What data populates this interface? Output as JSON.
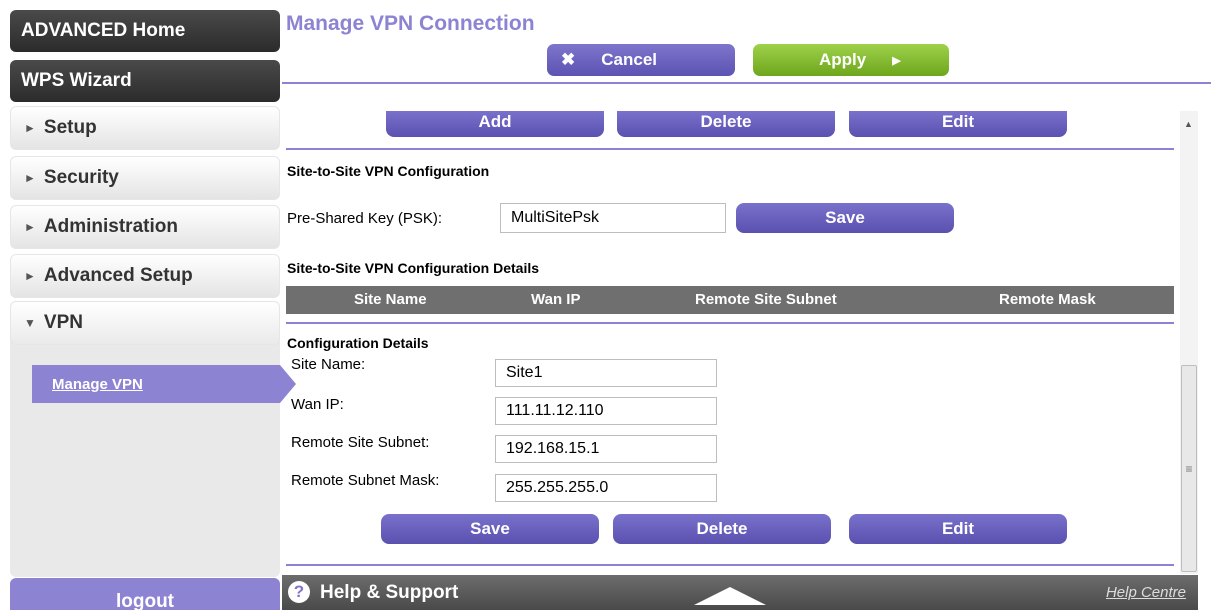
{
  "sidebar": {
    "advanced_home": "ADVANCED Home",
    "wps_wizard": "WPS Wizard",
    "items": [
      {
        "label": "Setup",
        "icon": "triangle-right-icon"
      },
      {
        "label": "Security",
        "icon": "triangle-right-icon"
      },
      {
        "label": "Administration",
        "icon": "triangle-right-icon"
      },
      {
        "label": "Advanced Setup",
        "icon": "triangle-right-icon"
      },
      {
        "label": "VPN",
        "icon": "triangle-down-icon"
      }
    ],
    "sub_item": "Manage VPN",
    "logout": "logout"
  },
  "header": {
    "title": "Manage VPN Connection",
    "cancel_label": "Cancel",
    "apply_label": "Apply"
  },
  "top_buttons": {
    "add": "Add",
    "delete": "Delete",
    "edit": "Edit"
  },
  "site_config": {
    "title": "Site-to-Site VPN Configuration",
    "psk_label": "Pre-Shared Key (PSK):",
    "psk_value": "MultiSitePsk",
    "save_label": "Save"
  },
  "details_table": {
    "title": "Site-to-Site VPN Configuration Details",
    "columns": [
      "Site Name",
      "Wan IP",
      "Remote Site Subnet",
      "Remote Mask"
    ]
  },
  "config_details": {
    "title": "Configuration Details",
    "fields": [
      {
        "label": "Site Name:",
        "value": "Site1"
      },
      {
        "label": "Wan IP:",
        "value": "111.11.12.110"
      },
      {
        "label": "Remote Site Subnet:",
        "value": "192.168.15.1"
      },
      {
        "label": "Remote Subnet Mask:",
        "value": "255.255.255.0"
      }
    ],
    "save_label": "Save",
    "delete_label": "Delete",
    "edit_label": "Edit"
  },
  "footer": {
    "help_support": "Help & Support",
    "help_centre": "Help Centre"
  },
  "colors": {
    "accent_purple": "#8c83d3",
    "apply_green": "#7fba2c",
    "header_dark": "#6f6f6f"
  }
}
